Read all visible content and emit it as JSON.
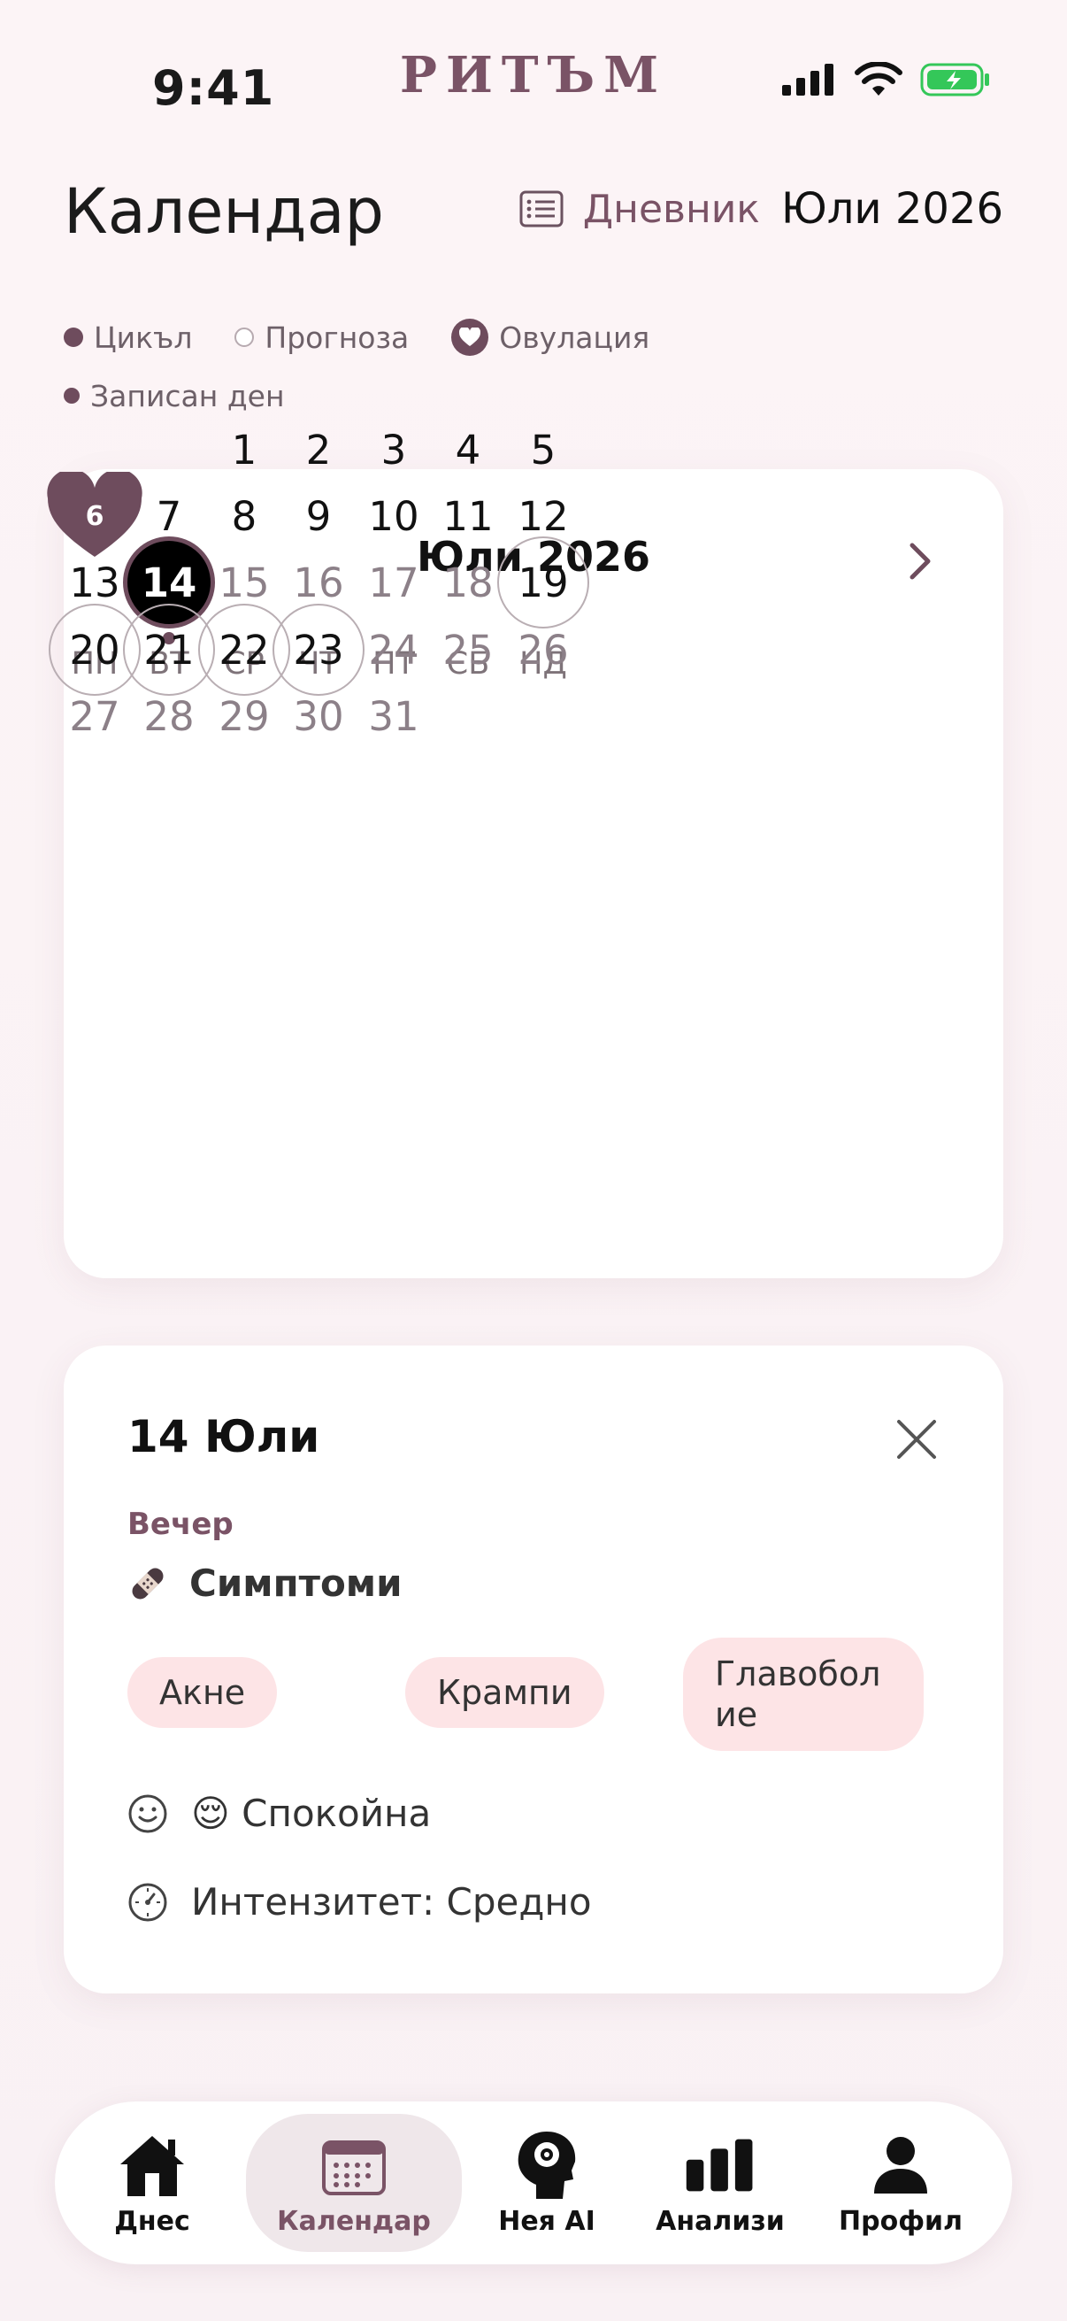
{
  "status": {
    "time": "9:41"
  },
  "brand": "РИТЪМ",
  "header": {
    "title": "Календар",
    "journal_label": "Дневник",
    "month": "Юли 2026"
  },
  "legend": [
    {
      "label": "Цикъл",
      "kind": "cycle"
    },
    {
      "label": "Прогноза",
      "kind": "forecast"
    },
    {
      "label": "Овулация",
      "kind": "ovulation"
    },
    {
      "label": "Записан ден",
      "kind": "logged"
    }
  ],
  "calendar": {
    "title": "Юли 2026",
    "weekdays": [
      "ПН",
      "ВТ",
      "СР",
      "ЧТ",
      "ПТ",
      "СБ",
      "НД"
    ],
    "days": [
      {
        "d": "1",
        "col": 2,
        "row": 0
      },
      {
        "d": "2",
        "col": 3,
        "row": 0
      },
      {
        "d": "3",
        "col": 4,
        "row": 0
      },
      {
        "d": "4",
        "col": 5,
        "row": 0
      },
      {
        "d": "5",
        "col": 6,
        "row": 0
      },
      {
        "d": "6",
        "col": 0,
        "row": 1,
        "state": "ovulation"
      },
      {
        "d": "7",
        "col": 1,
        "row": 1
      },
      {
        "d": "8",
        "col": 2,
        "row": 1
      },
      {
        "d": "9",
        "col": 3,
        "row": 1
      },
      {
        "d": "10",
        "col": 4,
        "row": 1
      },
      {
        "d": "11",
        "col": 5,
        "row": 1
      },
      {
        "d": "12",
        "col": 6,
        "row": 1
      },
      {
        "d": "13",
        "col": 0,
        "row": 2
      },
      {
        "d": "14",
        "col": 1,
        "row": 2,
        "state": "today"
      },
      {
        "d": "15",
        "col": 2,
        "row": 2,
        "state": "future"
      },
      {
        "d": "16",
        "col": 3,
        "row": 2,
        "state": "future"
      },
      {
        "d": "17",
        "col": 4,
        "row": 2,
        "state": "future"
      },
      {
        "d": "18",
        "col": 5,
        "row": 2,
        "state": "future"
      },
      {
        "d": "19",
        "col": 6,
        "row": 2,
        "state": "predicted"
      },
      {
        "d": "20",
        "col": 0,
        "row": 3,
        "state": "predicted"
      },
      {
        "d": "21",
        "col": 1,
        "row": 3,
        "state": "predicted"
      },
      {
        "d": "22",
        "col": 2,
        "row": 3,
        "state": "predicted"
      },
      {
        "d": "23",
        "col": 3,
        "row": 3,
        "state": "predicted"
      },
      {
        "d": "24",
        "col": 4,
        "row": 3,
        "state": "future"
      },
      {
        "d": "25",
        "col": 5,
        "row": 3,
        "state": "future"
      },
      {
        "d": "26",
        "col": 6,
        "row": 3,
        "state": "future"
      },
      {
        "d": "27",
        "col": 0,
        "row": 4,
        "state": "future"
      },
      {
        "d": "28",
        "col": 1,
        "row": 4,
        "state": "future"
      },
      {
        "d": "29",
        "col": 2,
        "row": 4,
        "state": "future"
      },
      {
        "d": "30",
        "col": 3,
        "row": 4,
        "state": "future"
      },
      {
        "d": "31",
        "col": 4,
        "row": 4,
        "state": "future"
      }
    ]
  },
  "detail": {
    "title": "14 Юли",
    "section": "Вечер",
    "symptoms_heading": "Симптоми",
    "symptoms": [
      "Акне",
      "Крампи",
      "Главоболие"
    ],
    "mood_emoji": "😌",
    "mood": "Спокойна",
    "intensity": "Интензитет: Средно"
  },
  "tabs": [
    {
      "label": "Днес",
      "icon": "home-icon"
    },
    {
      "label": "Календар",
      "icon": "calendar-icon",
      "active": true
    },
    {
      "label": "Нея AI",
      "icon": "ai-head-icon"
    },
    {
      "label": "Анализи",
      "icon": "bar-chart-icon"
    },
    {
      "label": "Профил",
      "icon": "person-icon"
    }
  ],
  "colors": {
    "accent": "#7A5366",
    "chip": "#FDE4E6",
    "battery": "#34C759"
  }
}
